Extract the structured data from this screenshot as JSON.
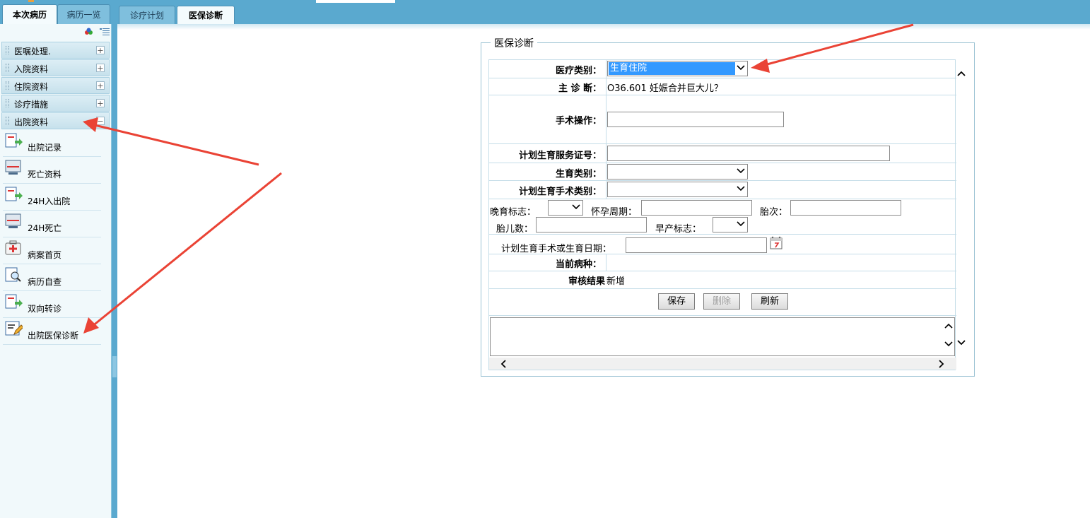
{
  "left_tabs": [
    {
      "label": "本次病历",
      "active": true
    },
    {
      "label": "病历一览",
      "active": false
    }
  ],
  "right_tabs": [
    {
      "label": "诊疗计划",
      "active": false
    },
    {
      "label": "医保诊断",
      "active": true
    }
  ],
  "sidebar": {
    "sections": [
      {
        "label": "医嘱处理.",
        "toggle": "+"
      },
      {
        "label": "入院资料",
        "toggle": "+"
      },
      {
        "label": "住院资料",
        "toggle": "+"
      },
      {
        "label": "诊疗措施",
        "toggle": "+"
      },
      {
        "label": "出院资料",
        "toggle": "−"
      }
    ],
    "items": [
      {
        "label": "出院记录",
        "icon": "document-arrow-icon"
      },
      {
        "label": "死亡资料",
        "icon": "monitor-icon"
      },
      {
        "label": "24H入出院",
        "icon": "document-arrow-icon"
      },
      {
        "label": "24H死亡",
        "icon": "monitor-icon"
      },
      {
        "label": "病案首页",
        "icon": "medical-kit-icon"
      },
      {
        "label": "病历自查",
        "icon": "magnifier-document-icon"
      },
      {
        "label": "双向转诊",
        "icon": "document-arrow-icon"
      },
      {
        "label": "出院医保诊断",
        "icon": "edit-document-icon"
      }
    ]
  },
  "form": {
    "legend": "医保诊断",
    "medical_type": {
      "label": "医疗类别：",
      "value": "生育住院"
    },
    "main_diag": {
      "label": "主 诊 断：",
      "value": "O36.601 妊娠合并巨大儿？"
    },
    "surgery": {
      "label": "手术操作：",
      "value": ""
    },
    "plan_cert": {
      "label": "计划生育服务证号：",
      "value": ""
    },
    "birth_type": {
      "label": "生育类别：",
      "value": ""
    },
    "plan_surgery_type": {
      "label": "计划生育手术类别：",
      "value": ""
    },
    "late_birth": {
      "label": "晚育标志：",
      "value": ""
    },
    "pregnancy_weeks": {
      "label": "怀孕周期：",
      "value": ""
    },
    "parity": {
      "label": "胎次：",
      "value": ""
    },
    "fetus_count": {
      "label": "胎儿数：",
      "value": ""
    },
    "premature": {
      "label": "早产标志：",
      "value": ""
    },
    "plan_date": {
      "label": "计划生育手术或生育日期：",
      "value": ""
    },
    "current_disease": {
      "label": "当前病种：",
      "value": ""
    },
    "audit_result": {
      "label": "审核结果",
      "value": "新增"
    },
    "buttons": {
      "save": "保存",
      "delete": "删除",
      "refresh": "刷新"
    }
  },
  "colors": {
    "header": "#5aa9cf",
    "sidebar_bg": "#f1f9fb",
    "selection": "#3399ff",
    "annotation_arrow": "#ea4335"
  }
}
